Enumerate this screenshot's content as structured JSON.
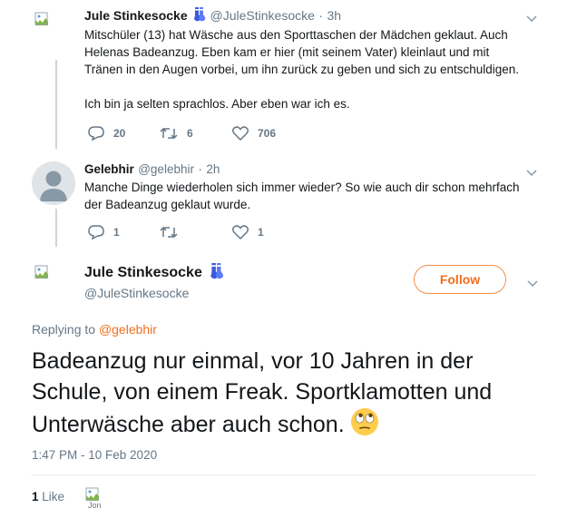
{
  "tweet1": {
    "name": "Jule Stinkesocke",
    "name_emoji_icon": "socks-icon",
    "handle": "@JuleStinkesocke",
    "separator": "·",
    "time": "3h",
    "line1": "Mitschüler (13) hat Wäsche aus den Sporttaschen der Mädchen geklaut. Auch",
    "line2": "Helenas Badeanzug. Eben kam er hier (mit seinem Vater) kleinlaut und mit",
    "line3": "Tränen in den Augen vorbei, um ihn zurück zu geben und sich zu entschuldigen.",
    "line4": "Ich bin ja selten sprachlos. Aber eben war ich es.",
    "replies": "20",
    "retweets": "6",
    "likes": "706"
  },
  "tweet2": {
    "name": "Gelebhir",
    "handle": "@gelebhir",
    "separator": "·",
    "time": "2h",
    "line1": "Manche Dinge wiederholen sich immer wieder? So wie auch dir schon mehrfach",
    "line2": "der Badeanzug geklaut wurde.",
    "replies": "1",
    "retweets": "",
    "likes": "1"
  },
  "main": {
    "name": "Jule Stinkesocke",
    "handle": "@JuleStinkesocke",
    "follow_label": "Follow",
    "replying_prefix": "Replying to",
    "replying_to": "@gelebhir",
    "line1": "Badeanzug nur einmal, vor 10 Jahren in der",
    "line2": "Schule, von einem Freak. Sportklamotten und",
    "line3": "Unterwäsche aber auch schon.",
    "emoji_icon": "face-with-rolling-eyes-icon",
    "timestamp": "1:47 PM - 10 Feb 2020",
    "likes_count": "1",
    "likes_label": "Like",
    "liker_avatar_alt": "Jon"
  },
  "colors": {
    "accent_orange": "#f06e1e",
    "text": "#14171a",
    "muted": "#657786",
    "thread_line": "#ccd6dd"
  }
}
